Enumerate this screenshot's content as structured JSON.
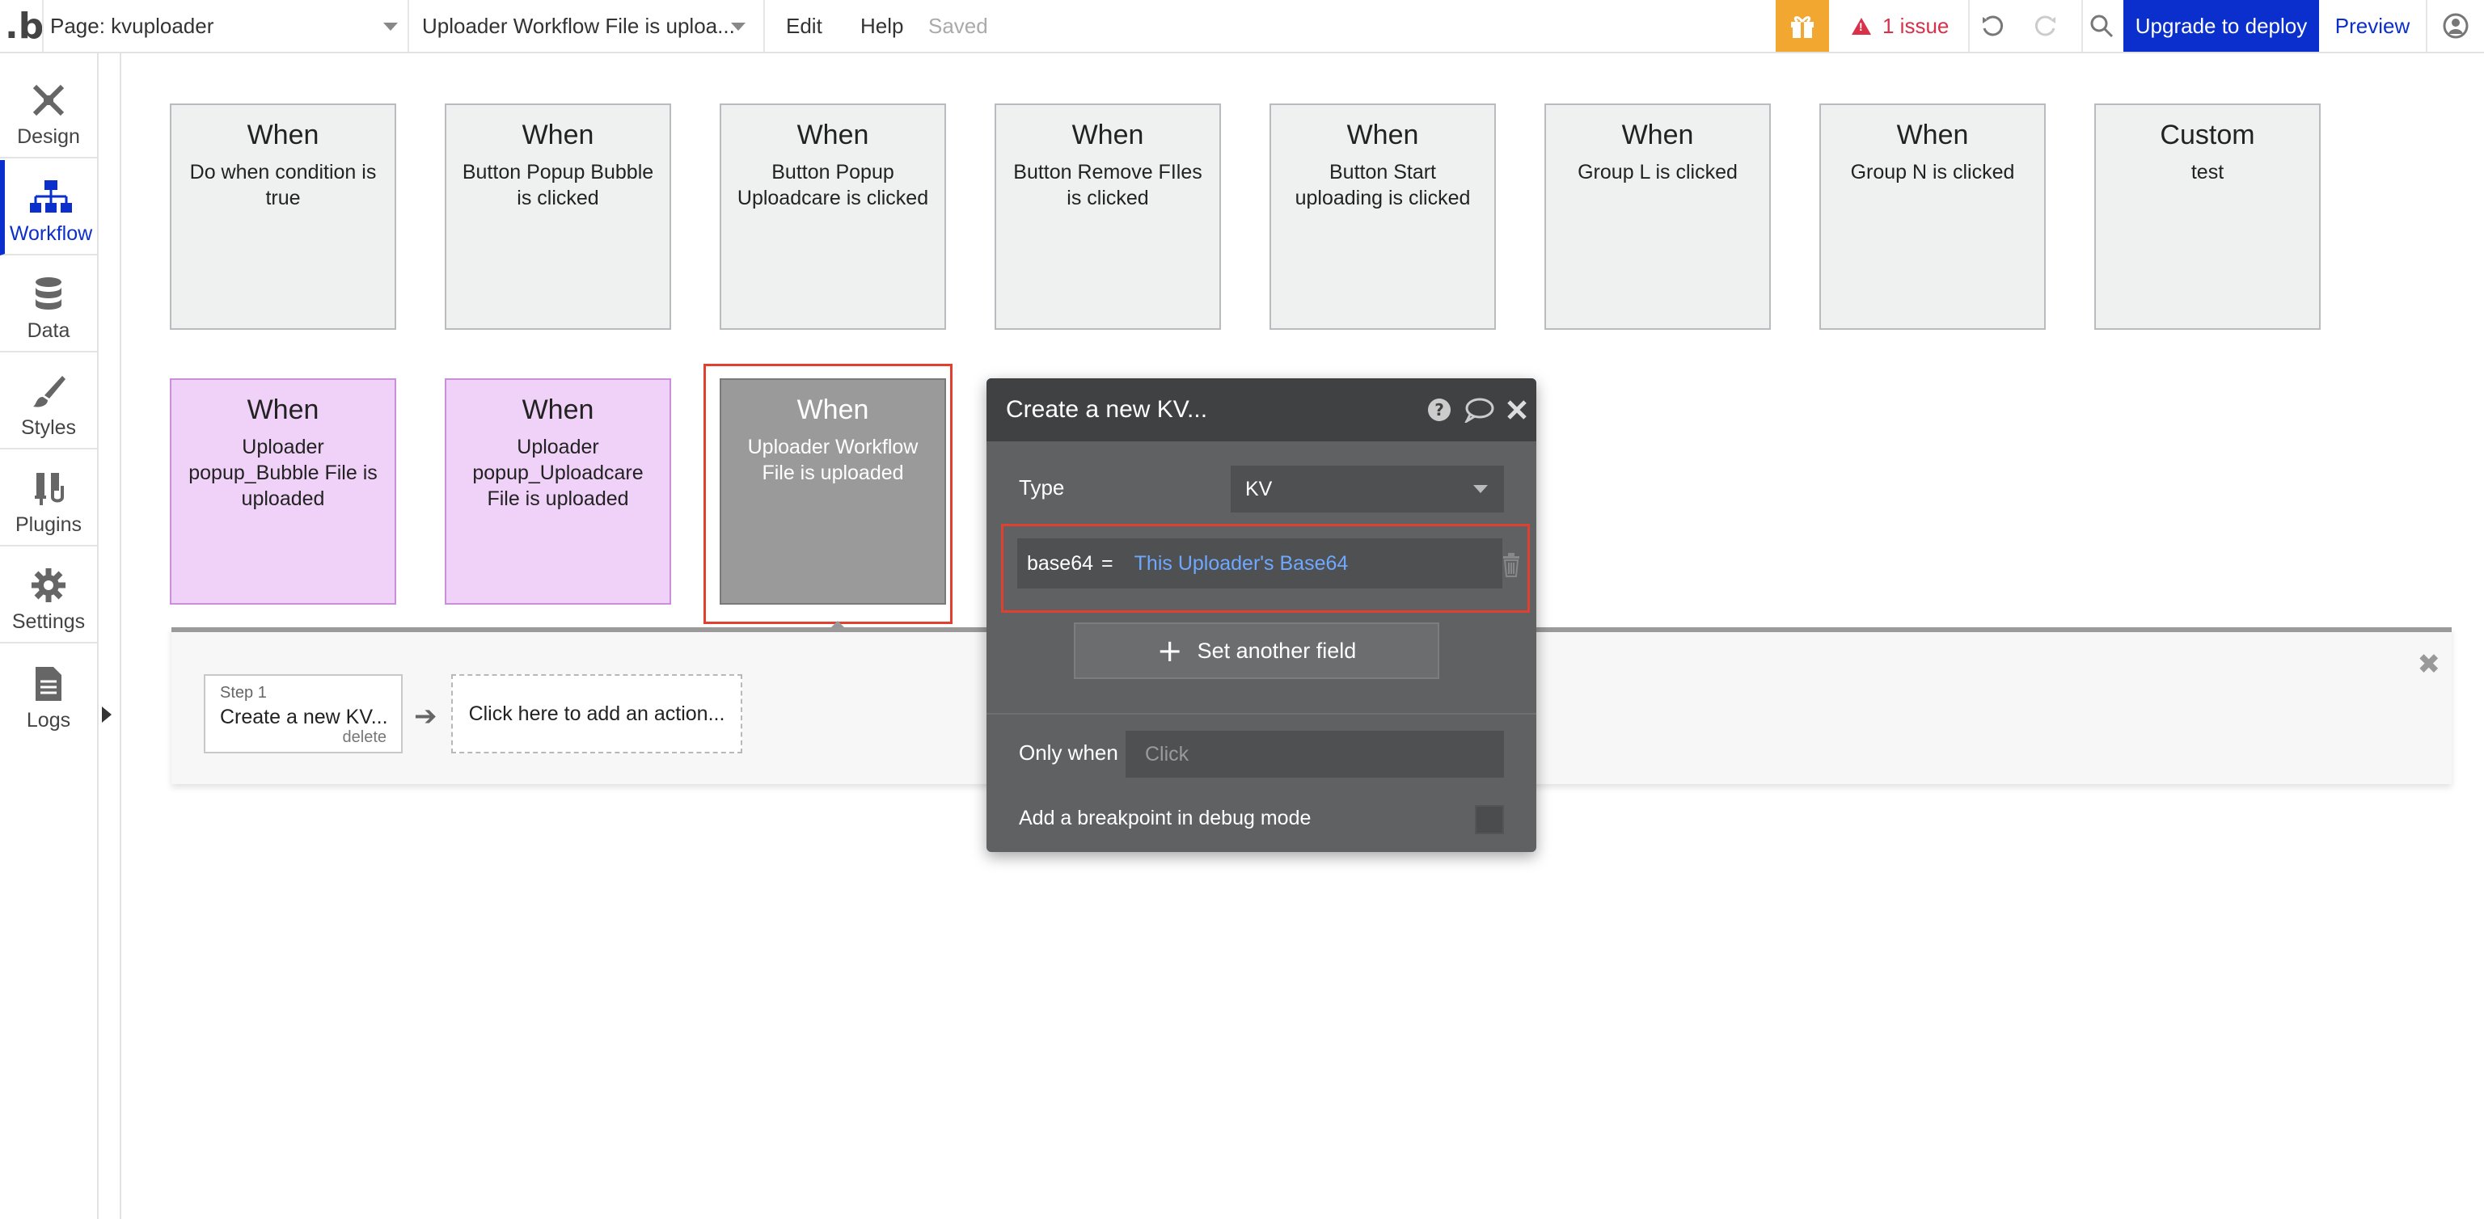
{
  "topbar": {
    "page_label": "Page: kvuploader",
    "workflow_label": "Uploader Workflow File is uploa...",
    "edit": "Edit",
    "help": "Help",
    "saved": "Saved",
    "issues": "1 issue",
    "upgrade": "Upgrade to deploy",
    "preview": "Preview",
    "accent_color": "#0a2fcc",
    "gift_color": "#f1a730"
  },
  "sidebar": {
    "items": [
      {
        "label": "Design",
        "icon": "design-icon"
      },
      {
        "label": "Workflow",
        "icon": "workflow-icon"
      },
      {
        "label": "Data",
        "icon": "database-icon"
      },
      {
        "label": "Styles",
        "icon": "brush-icon"
      },
      {
        "label": "Plugins",
        "icon": "plug-icon"
      },
      {
        "label": "Settings",
        "icon": "gear-icon"
      },
      {
        "label": "Logs",
        "icon": "document-icon"
      }
    ]
  },
  "events": {
    "row1": [
      {
        "title": "When",
        "subtitle": "Do when condition is true"
      },
      {
        "title": "When",
        "subtitle": "Button Popup Bubble is clicked"
      },
      {
        "title": "When",
        "subtitle": "Button Popup Uploadcare is clicked"
      },
      {
        "title": "When",
        "subtitle": "Button Remove FIles is clicked"
      },
      {
        "title": "When",
        "subtitle": "Button Start uploading is clicked"
      },
      {
        "title": "When",
        "subtitle": "Group L is clicked"
      },
      {
        "title": "When",
        "subtitle": "Group N is clicked"
      },
      {
        "title": "Custom",
        "subtitle": "test"
      }
    ],
    "row2": [
      {
        "title": "When",
        "subtitle": "Uploader popup_Bubble File is uploaded"
      },
      {
        "title": "When",
        "subtitle": "Uploader popup_Uploadcare File is uploaded"
      },
      {
        "title": "When",
        "subtitle": "Uploader Workflow File is uploaded"
      }
    ]
  },
  "workflow": {
    "step_label": "Step 1",
    "step_name": "Create a new KV...",
    "step_delete": "delete",
    "add_action": "Click here to add an action..."
  },
  "popup": {
    "title": "Create a new KV...",
    "type_label": "Type",
    "type_value": "KV",
    "field_name": "base64",
    "field_eq": "=",
    "field_value": "This Uploader's Base64",
    "set_another": "Set another field",
    "only_when_label": "Only when",
    "only_when_placeholder": "Click",
    "breakpoint_label": "Add a breakpoint in debug mode"
  }
}
